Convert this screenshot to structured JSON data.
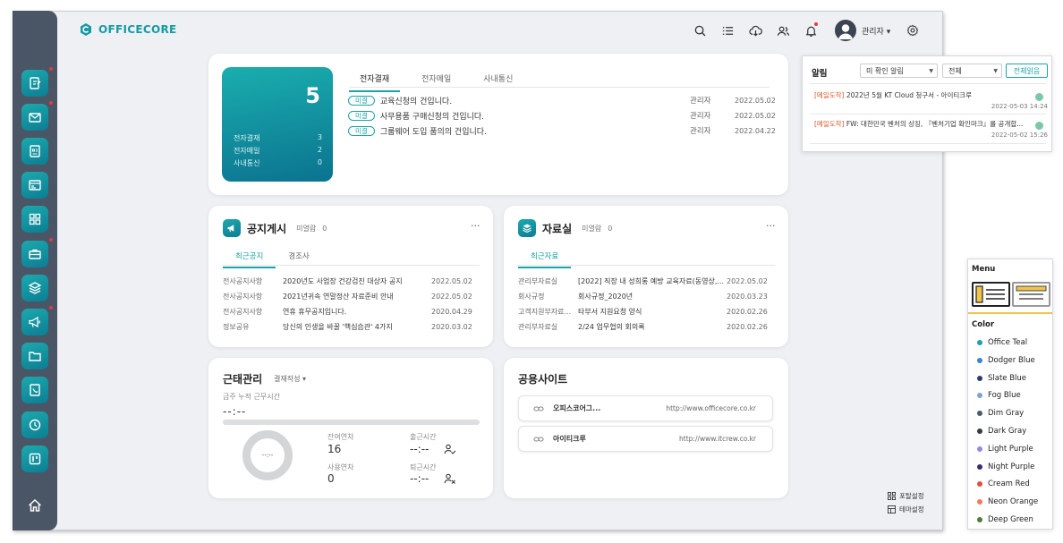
{
  "brand": {
    "name": "OFFICECORE"
  },
  "user": {
    "name": "관리자 ▾"
  },
  "approval": {
    "count": "5",
    "summary": [
      {
        "label": "전자결재",
        "value": "3"
      },
      {
        "label": "전자메일",
        "value": "2"
      },
      {
        "label": "사내통신",
        "value": "0"
      }
    ],
    "tabs": [
      "전자결재",
      "전자메일",
      "사내통신"
    ],
    "items": [
      {
        "badge": "미결",
        "title": "교육신청의 건입니다.",
        "author": "관리자",
        "date": "2022.05.02"
      },
      {
        "badge": "미결",
        "title": "사무용품 구매신청의 건입니다.",
        "author": "관리자",
        "date": "2022.05.02"
      },
      {
        "badge": "미결",
        "title": "그룹웨어 도입 품의의 건입니다.",
        "author": "관리자",
        "date": "2022.04.22"
      }
    ]
  },
  "notice": {
    "title": "공지게시",
    "unread_label": "미열람",
    "unread_count": "0",
    "more": "···",
    "tabs": [
      "최근공지",
      "경조사"
    ],
    "items": [
      {
        "cat": "전사공지사항",
        "title": "2020년도 사업장 건강검진 대상자 공지",
        "date": "2022.05.02"
      },
      {
        "cat": "전사공지사항",
        "title": "2021년귀속 연말정산 자료준비 안내",
        "date": "2022.05.02"
      },
      {
        "cat": "전사공지사항",
        "title": "연휴 휴무공지입니다.",
        "date": "2020.04.29"
      },
      {
        "cat": "정보공유",
        "title": "당신의 인생을 바꿀 '핵심습관' 4가지",
        "date": "2020.03.02"
      }
    ]
  },
  "archive": {
    "title": "자료실",
    "unread_label": "미열람",
    "unread_count": "0",
    "more": "···",
    "tabs": [
      "최근자료"
    ],
    "items": [
      {
        "cat": "관리부자료실",
        "title": "[2022] 직장 내 성희롱 예방 교육자료(동영상,...",
        "date": "2022.05.02"
      },
      {
        "cat": "회사규정",
        "title": "회사규정_2020년",
        "date": "2020.03.23"
      },
      {
        "cat": "고객지원부자료...",
        "title": "타부서 지원요청 양식",
        "date": "2020.02.26"
      },
      {
        "cat": "관리부자료실",
        "title": "2/24 업무협의 회의록",
        "date": "2020.02.26"
      }
    ]
  },
  "attendance": {
    "title": "근태관리",
    "state": "결재작성 ▾",
    "week_label": "금주 누적 근무시간",
    "week_value": "--:--",
    "donut_value": "--:--",
    "remaining_label": "잔여연차",
    "remaining_value": "16",
    "used_label": "사용연차",
    "used_value": "0",
    "checkin_label": "출근시간",
    "checkin_value": "--:--",
    "checkout_label": "퇴근시간",
    "checkout_value": "--:--"
  },
  "sites": {
    "title": "공용사이트",
    "items": [
      {
        "name": "오피스코어그...",
        "url": "http://www.officecore.co.kr"
      },
      {
        "name": "아이티크루",
        "url": "http://www.itcrew.co.kr"
      }
    ]
  },
  "footer": {
    "portal_settings": "포탈설정",
    "theme_settings": "테마설정"
  },
  "alarm": {
    "title": "알림",
    "filter1": "미 확인 알림",
    "filter2": "전체",
    "read_all": "전체읽음",
    "items": [
      {
        "tag": "[메일도착]",
        "text": " 2022년 5월 KT Cloud 청구서 - 아이티크루",
        "date": "2022-05-03 14:24"
      },
      {
        "tag": "[메일도착]",
        "text": " FW: 대한민국 벤처의 상징, 『벤처기업 확인마크』를 공개합...",
        "date": "2022-05-02 15:26"
      }
    ]
  },
  "theme": {
    "menu_label": "Menu",
    "color_label": "Color",
    "colors": [
      {
        "name": "Office Teal",
        "hex": "#1aa3a9"
      },
      {
        "name": "Dodger Blue",
        "hex": "#3b82d6"
      },
      {
        "name": "Slate Blue",
        "hex": "#2c3e63"
      },
      {
        "name": "Fog Blue",
        "hex": "#7fa3c9"
      },
      {
        "name": "Dim Gray",
        "hex": "#4d5a66"
      },
      {
        "name": "Dark Gray",
        "hex": "#333d44"
      },
      {
        "name": "Light Purple",
        "hex": "#9b86d9"
      },
      {
        "name": "Night Purple",
        "hex": "#3e2a73"
      },
      {
        "name": "Cream Red",
        "hex": "#e0503e"
      },
      {
        "name": "Neon Orange",
        "hex": "#f57a5a"
      },
      {
        "name": "Deep Green",
        "hex": "#4e7d3a"
      }
    ]
  }
}
